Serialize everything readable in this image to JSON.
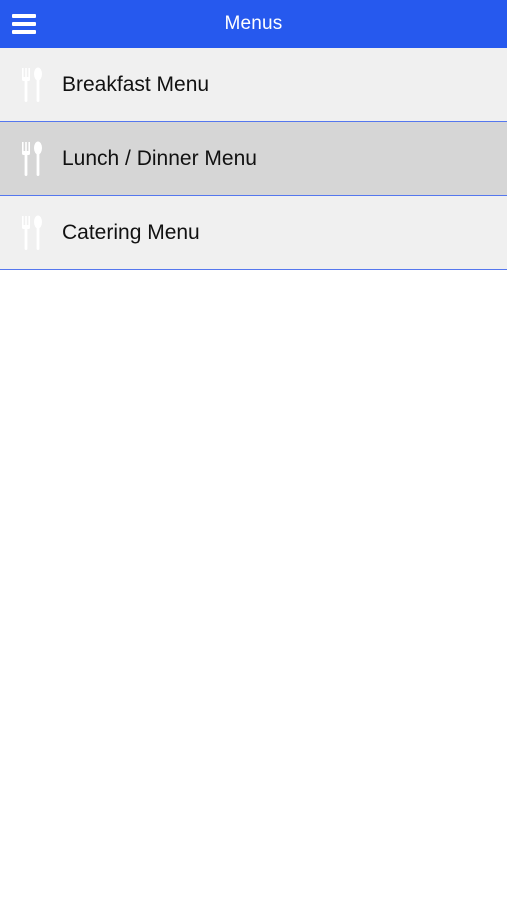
{
  "header": {
    "title": "Menus",
    "menu_icon": "hamburger-menu-icon",
    "background_color": "#2659ee"
  },
  "menus": [
    {
      "label": "Breakfast Menu",
      "icon": "fork-spoon-icon",
      "selected": false
    },
    {
      "label": "Lunch / Dinner Menu",
      "icon": "fork-spoon-icon",
      "selected": true
    },
    {
      "label": "Catering Menu",
      "icon": "fork-spoon-icon",
      "selected": false
    }
  ],
  "colors": {
    "row_background": "#f0f0f0",
    "row_selected_background": "#d6d6d6",
    "row_divider": "#5577ee",
    "icon": "#ffffff"
  }
}
